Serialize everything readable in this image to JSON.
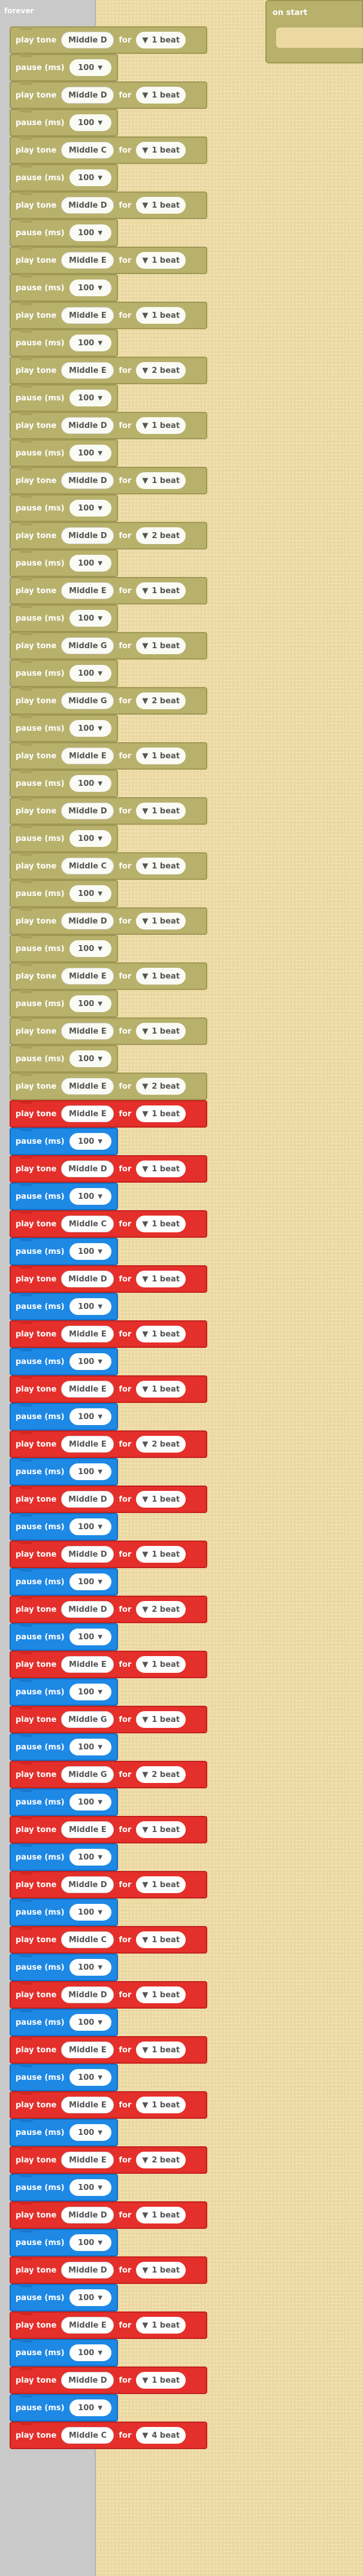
{
  "forever": {
    "label": "forever"
  },
  "on_start": {
    "label": "on start"
  },
  "labels": {
    "play_tone": "play tone",
    "for": "for",
    "pause": "pause (ms)",
    "caret": "▼"
  },
  "colors": {
    "olive": "#b8b16c",
    "red": "#e42f2b",
    "blue": "#1e88e5",
    "forever_gray": "#c9c9c9",
    "workspace": "#ecd9a2"
  },
  "olive_tones": [
    {
      "note": "Middle D",
      "beat": "1 beat",
      "ms": "100"
    },
    {
      "note": "Middle D",
      "beat": "1 beat",
      "ms": "100"
    },
    {
      "note": "Middle C",
      "beat": "1 beat",
      "ms": "100"
    },
    {
      "note": "Middle D",
      "beat": "1 beat",
      "ms": "100"
    },
    {
      "note": "Middle E",
      "beat": "1 beat",
      "ms": "100"
    },
    {
      "note": "Middle E",
      "beat": "1 beat",
      "ms": "100"
    },
    {
      "note": "Middle E",
      "beat": "2 beat",
      "ms": "100"
    },
    {
      "note": "Middle D",
      "beat": "1 beat",
      "ms": "100"
    },
    {
      "note": "Middle D",
      "beat": "1 beat",
      "ms": "100"
    },
    {
      "note": "Middle D",
      "beat": "2 beat",
      "ms": "100"
    },
    {
      "note": "Middle E",
      "beat": "1 beat",
      "ms": "100"
    },
    {
      "note": "Middle G",
      "beat": "1 beat",
      "ms": "100"
    },
    {
      "note": "Middle G",
      "beat": "2 beat",
      "ms": "100"
    },
    {
      "note": "Middle E",
      "beat": "1 beat",
      "ms": "100"
    },
    {
      "note": "Middle D",
      "beat": "1 beat",
      "ms": "100"
    },
    {
      "note": "Middle C",
      "beat": "1 beat",
      "ms": "100"
    },
    {
      "note": "Middle D",
      "beat": "1 beat",
      "ms": "100"
    },
    {
      "note": "Middle E",
      "beat": "1 beat",
      "ms": "100"
    },
    {
      "note": "Middle E",
      "beat": "1 beat",
      "ms": "100"
    },
    {
      "note": "Middle E",
      "beat": "2 beat",
      "ms": null
    }
  ],
  "red_tones": [
    {
      "note": "Middle E",
      "beat": "1 beat",
      "ms": "100"
    },
    {
      "note": "Middle D",
      "beat": "1 beat",
      "ms": "100"
    },
    {
      "note": "Middle C",
      "beat": "1 beat",
      "ms": "100"
    },
    {
      "note": "Middle D",
      "beat": "1 beat",
      "ms": "100"
    },
    {
      "note": "Middle E",
      "beat": "1 beat",
      "ms": "100"
    },
    {
      "note": "Middle E",
      "beat": "1 beat",
      "ms": "100"
    },
    {
      "note": "Middle E",
      "beat": "2 beat",
      "ms": "100"
    },
    {
      "note": "Middle D",
      "beat": "1 beat",
      "ms": "100"
    },
    {
      "note": "Middle D",
      "beat": "1 beat",
      "ms": "100"
    },
    {
      "note": "Middle D",
      "beat": "2 beat",
      "ms": "100"
    },
    {
      "note": "Middle E",
      "beat": "1 beat",
      "ms": "100"
    },
    {
      "note": "Middle G",
      "beat": "1 beat",
      "ms": "100"
    },
    {
      "note": "Middle G",
      "beat": "2 beat",
      "ms": "100"
    },
    {
      "note": "Middle E",
      "beat": "1 beat",
      "ms": "100"
    },
    {
      "note": "Middle D",
      "beat": "1 beat",
      "ms": "100"
    },
    {
      "note": "Middle C",
      "beat": "1 beat",
      "ms": "100"
    },
    {
      "note": "Middle D",
      "beat": "1 beat",
      "ms": "100"
    },
    {
      "note": "Middle E",
      "beat": "1 beat",
      "ms": "100"
    },
    {
      "note": "Middle E",
      "beat": "1 beat",
      "ms": "100"
    },
    {
      "note": "Middle E",
      "beat": "2 beat",
      "ms": "100"
    },
    {
      "note": "Middle D",
      "beat": "1 beat",
      "ms": "100"
    },
    {
      "note": "Middle D",
      "beat": "1 beat",
      "ms": "100"
    },
    {
      "note": "Middle E",
      "beat": "1 beat",
      "ms": "100"
    },
    {
      "note": "Middle D",
      "beat": "1 beat",
      "ms": "100"
    },
    {
      "note": "Middle C",
      "beat": "4 beat",
      "ms": null
    }
  ]
}
